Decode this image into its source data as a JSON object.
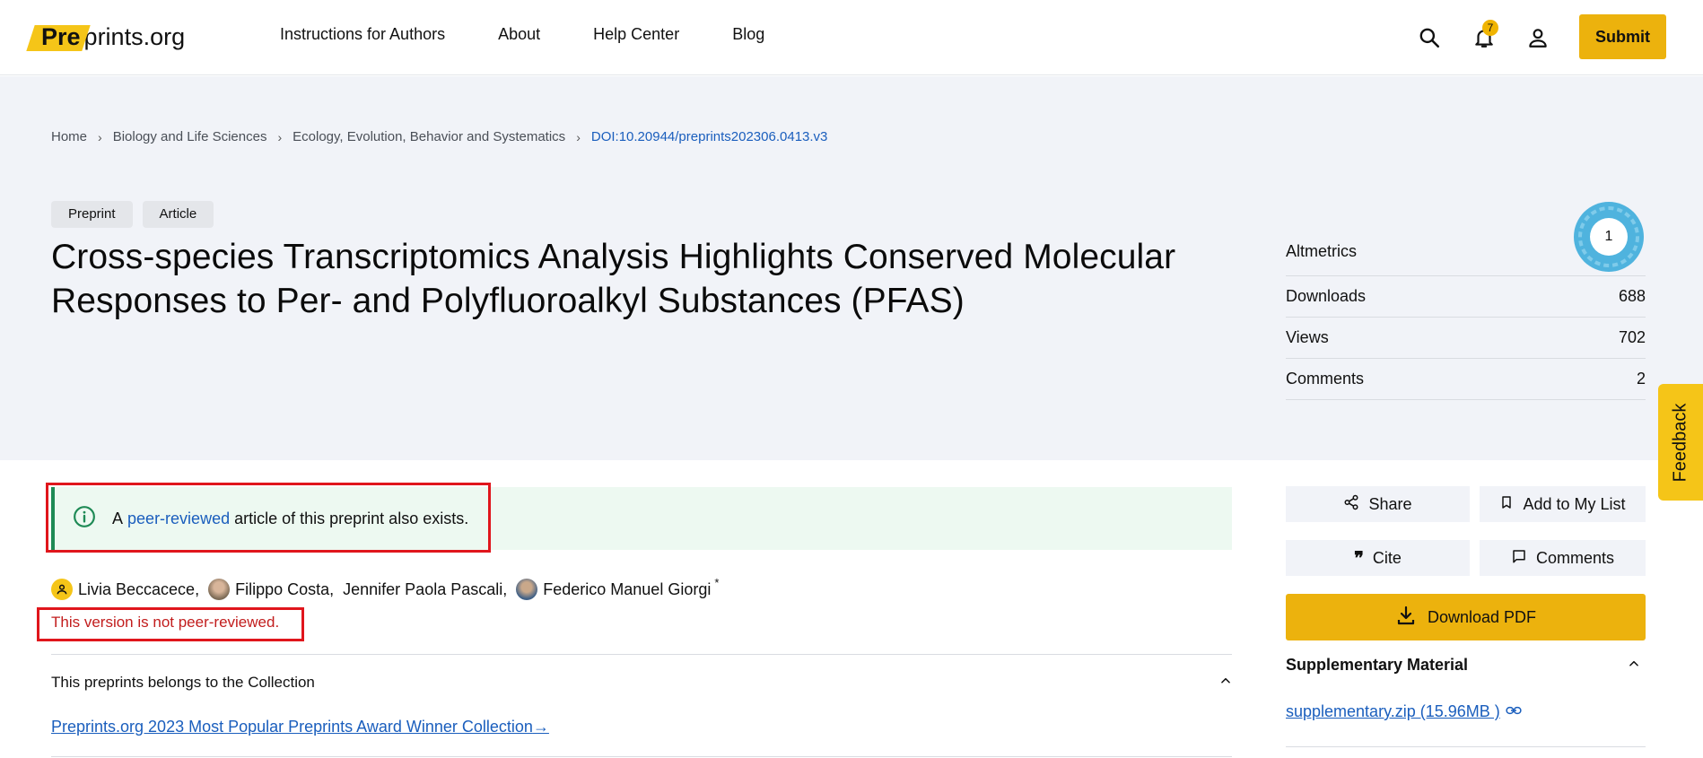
{
  "header": {
    "logo_pre": "Pre",
    "logo_rest": "prints.org",
    "nav": [
      "Instructions for Authors",
      "About",
      "Help Center",
      "Blog"
    ],
    "notification_count": "7",
    "submit_label": "Submit"
  },
  "breadcrumb": [
    "Home",
    "Biology and Life Sciences",
    "Ecology, Evolution, Behavior and Systematics",
    "DOI:10.20944/preprints202306.0413.v3"
  ],
  "tags": [
    "Preprint",
    "Article"
  ],
  "title": "Cross-species Transcriptomics Analysis Highlights Conserved Molecular Responses to Per- and Polyfluoroalkyl Substances (PFAS)",
  "metrics": {
    "altmetrics_label": "Altmetrics",
    "altmetrics_score": "1",
    "downloads_label": "Downloads",
    "downloads": "688",
    "views_label": "Views",
    "views": "702",
    "comments_label": "Comments",
    "comments": "2"
  },
  "feedback_label": "Feedback",
  "notice": {
    "prefix": "A",
    "link": "peer-reviewed",
    "suffix": "article of this preprint also exists."
  },
  "authors": [
    "Livia Beccacece,",
    "Filippo Costa,",
    "Jennifer Paola Pascali,",
    "Federico Manuel Giorgi"
  ],
  "author_mark": "*",
  "not_reviewed": "This version is not peer-reviewed.",
  "collection": {
    "heading": "This preprints belongs to the Collection",
    "link": "Preprints.org 2023 Most Popular Preprints Award Winner Collection",
    "arrow": "→"
  },
  "actions": {
    "share": "Share",
    "add_list": "Add to My List",
    "cite": "Cite",
    "comments": "Comments",
    "download_pdf": "Download PDF"
  },
  "supplementary": {
    "heading": "Supplementary Material",
    "file": "supplementary.zip (15.96MB )"
  },
  "colors": {
    "brand_yellow": "#ecb20d",
    "link_blue": "#1a5ebd",
    "notice_green": "#1e8a55",
    "warning_red": "#c21d1d",
    "highlight_red": "#e0161c"
  }
}
